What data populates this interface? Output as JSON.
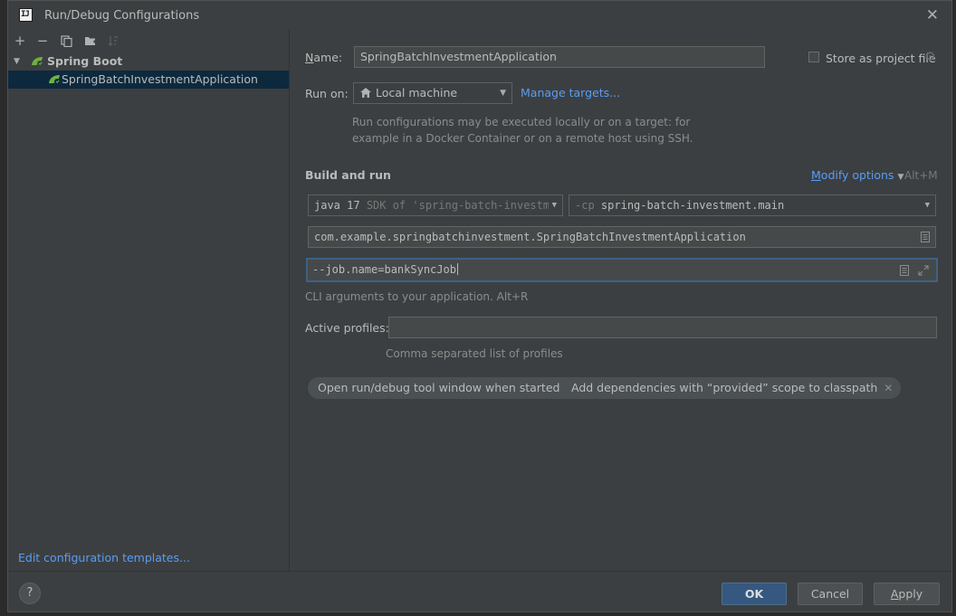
{
  "window": {
    "title": "Run/Debug Configurations",
    "app_icon": "IJ"
  },
  "toolbar": {
    "add_icon": "+",
    "remove_icon": "−",
    "copy_icon": "copy-icon",
    "folder_icon": "new-folder-icon",
    "sort_icon": "sort-icon"
  },
  "tree": {
    "group_label": "Spring Boot",
    "items": [
      {
        "label": "SpringBatchInvestmentApplication",
        "selected": true
      }
    ]
  },
  "left_footer": {
    "edit_templates_link": "Edit configuration templates..."
  },
  "form": {
    "name_label": "Name:",
    "name_value": "SpringBatchInvestmentApplication",
    "store_as_project_file_label": "Store as project file",
    "run_on_label": "Run on:",
    "run_on_value": "Local machine",
    "manage_targets_link": "Manage targets...",
    "run_on_hint_line1": "Run configurations may be executed locally or on a target: for",
    "run_on_hint_line2": "example in a Docker Container or on a remote host using SSH.",
    "build_and_run_title": "Build and run",
    "modify_options_link": "Modify options",
    "modify_options_shortcut": "Alt+M",
    "jdk_main": "java 17",
    "jdk_detail": "SDK of 'spring-batch-investm",
    "classpath_prefix": "-cp",
    "classpath_value": "spring-batch-investment.main",
    "main_class_value": "com.example.springbatchinvestment.SpringBatchInvestmentApplication",
    "program_args_value": "--job.name=bankSyncJob",
    "program_args_hint": "CLI arguments to your application. Alt+R",
    "active_profiles_label": "Active profiles:",
    "active_profiles_value": "",
    "active_profiles_hint": "Comma separated list of profiles",
    "chips": [
      {
        "label": "Open run/debug tool window when started"
      },
      {
        "label": "Add dependencies with “provided” scope to classpath"
      }
    ]
  },
  "footer": {
    "help_label": "?",
    "ok_label": "OK",
    "cancel_label": "Cancel",
    "apply_label": "Apply"
  },
  "colors": {
    "accent": "#589df6",
    "primary_button": "#365880",
    "selection": "#0d293e",
    "spring_green": "#6db33f"
  }
}
